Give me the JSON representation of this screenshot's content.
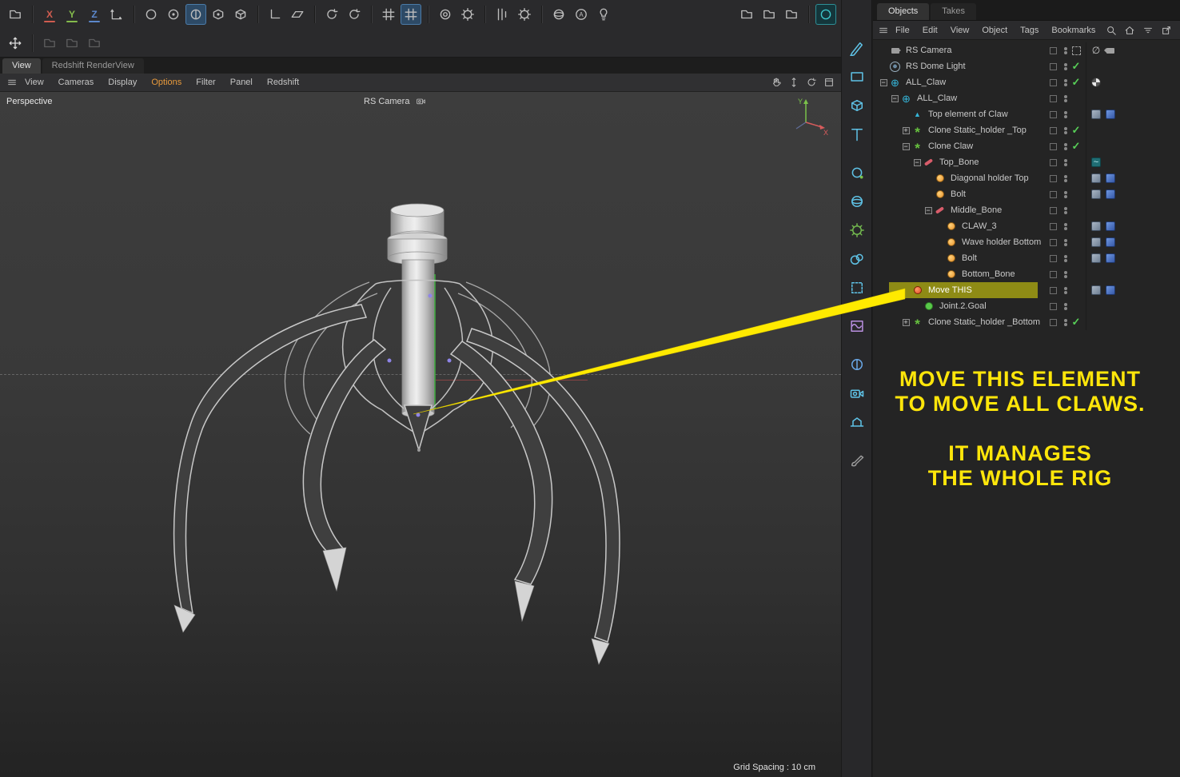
{
  "toolbar": {
    "row1": [
      {
        "items": [
          {
            "name": "content-browser-button",
            "icon": "foldbox"
          }
        ]
      },
      {
        "items": [
          {
            "name": "lock-x-axis-button",
            "letter": "X",
            "color": "#d05c50"
          },
          {
            "name": "lock-y-axis-button",
            "letter": "Y",
            "color": "#84bb4c"
          },
          {
            "name": "lock-z-axis-button",
            "letter": "Z",
            "color": "#5c88cc"
          },
          {
            "name": "coordinate-system-button",
            "icon": "axes"
          }
        ]
      },
      {
        "items": [
          {
            "name": "make-editable-button",
            "icon": "ring"
          },
          {
            "name": "model-mode-button",
            "icon": "ringdot"
          },
          {
            "name": "texture-mode-button",
            "icon": "halfring",
            "active": true
          },
          {
            "name": "point-mode-button",
            "icon": "cubedot"
          },
          {
            "name": "polygon-mode-button",
            "icon": "cube"
          }
        ]
      },
      {
        "items": [
          {
            "name": "enable-axis-button",
            "icon": "corner"
          },
          {
            "name": "workplane-button",
            "icon": "plane"
          }
        ]
      },
      {
        "items": [
          {
            "name": "reset-psr-button",
            "icon": "rotate"
          },
          {
            "name": "rotate-snap-button",
            "icon": "rotate"
          }
        ]
      },
      {
        "items": [
          {
            "name": "snap-toggle-button",
            "icon": "grid"
          },
          {
            "name": "quantize-button",
            "icon": "grid",
            "active": true
          }
        ]
      },
      {
        "items": [
          {
            "name": "target-mode-button",
            "icon": "target"
          },
          {
            "name": "snap-settings-button",
            "icon": "gearring"
          }
        ]
      },
      {
        "items": [
          {
            "name": "guide-lines-button",
            "icon": "lines"
          },
          {
            "name": "modeling-settings-button",
            "icon": "gearring"
          }
        ]
      },
      {
        "items": [
          {
            "name": "sphere-tool-button",
            "icon": "sphere"
          },
          {
            "name": "annotate-tool-button",
            "icon": "lettera"
          },
          {
            "name": "pick-tool-button",
            "icon": "lamp"
          }
        ]
      },
      {
        "push": true,
        "items": [
          {
            "name": "workplane-preset-1-button",
            "icon": "foldbox"
          },
          {
            "name": "workplane-preset-2-button",
            "icon": "foldbox"
          },
          {
            "name": "workplane-preset-3-button",
            "icon": "foldbox"
          }
        ]
      },
      {
        "items": [
          {
            "name": "modeling-circle-button",
            "icon": "ring",
            "accent": true,
            "color": "#3ec8cc"
          }
        ]
      }
    ],
    "row2": [
      {
        "items": [
          {
            "name": "move-tool-button",
            "icon": "movearrows",
            "color": "#d8d8d8"
          }
        ]
      },
      {
        "items": [
          {
            "name": "recent-tool-1-button",
            "icon": "foldbox",
            "disabled": true
          },
          {
            "name": "recent-tool-2-button",
            "icon": "foldbox",
            "disabled": true
          },
          {
            "name": "recent-tool-3-button",
            "icon": "foldbox",
            "disabled": true
          }
        ]
      }
    ]
  },
  "palette": [
    {
      "name": "spline-pen-tool",
      "icon": "pen",
      "color": "#5fc3e7"
    },
    {
      "name": "spline-primitive-tool",
      "icon": "rect",
      "color": "#5fc3e7"
    },
    {
      "name": "primitive-cube-tool",
      "icon": "cube",
      "color": "#5fc3e7"
    },
    {
      "name": "mograph-text-tool",
      "icon": "text",
      "color": "#5fc3e7"
    },
    {
      "name": "generator-tool",
      "icon": "gencircle",
      "color": "#5fc3e7",
      "gap": true
    },
    {
      "name": "subdivision-surface-tool",
      "icon": "sphere",
      "color": "#5fc3e7"
    },
    {
      "name": "simulation-tool",
      "icon": "gearring",
      "color": "#72b84e"
    },
    {
      "name": "volume-builder-tool",
      "icon": "blob",
      "color": "#5fc3e7"
    },
    {
      "name": "volume-mesher-tool",
      "icon": "dotcube",
      "color": "#5fc3e7"
    },
    {
      "name": "deformer-tool",
      "icon": "wavecube",
      "color": "#b98fe0",
      "gap": true
    },
    {
      "name": "field-tool",
      "icon": "fieldsphere",
      "color": "#6aa8e8",
      "gap": true
    },
    {
      "name": "camera-tool",
      "icon": "camera",
      "color": "#5fc3e7"
    },
    {
      "name": "stage-tool",
      "icon": "stage",
      "color": "#5fc3e7"
    },
    {
      "name": "material-paint-tool",
      "icon": "brush",
      "color": "#9a9a9a",
      "gap": true
    }
  ],
  "viewport": {
    "tabs": [
      {
        "label": "View",
        "active": true
      },
      {
        "label": "Redshift RenderView",
        "active": false
      }
    ],
    "menu": [
      {
        "label": "View"
      },
      {
        "label": "Cameras"
      },
      {
        "label": "Display"
      },
      {
        "label": "Options",
        "accent": true
      },
      {
        "label": "Filter"
      },
      {
        "label": "Panel"
      },
      {
        "label": "Redshift"
      }
    ],
    "menu_icons": [
      {
        "name": "pan-view-icon",
        "icon": "hand"
      },
      {
        "name": "dolly-view-icon",
        "icon": "updown"
      },
      {
        "name": "rotate-view-icon",
        "icon": "rotate"
      },
      {
        "name": "toggle-panel-icon",
        "icon": "frame"
      }
    ],
    "view_label": "Perspective",
    "camera_label": "RS Camera",
    "grid_spacing_label": "Grid Spacing : 10 cm",
    "axis_labels": {
      "x": "X",
      "y": "Y"
    }
  },
  "object_manager": {
    "tabs": [
      {
        "label": "Objects",
        "active": true
      },
      {
        "label": "Takes",
        "active": false
      }
    ],
    "menu": [
      "File",
      "Edit",
      "View",
      "Object",
      "Tags",
      "Bookmarks"
    ],
    "menu_icons": [
      {
        "name": "search-icon",
        "icon": "magnifier"
      },
      {
        "name": "home-icon",
        "icon": "home"
      },
      {
        "name": "filter-icon",
        "icon": "filter"
      },
      {
        "name": "new-window-icon",
        "icon": "export"
      }
    ],
    "rows": [
      {
        "label": "RS Camera",
        "indent": 0,
        "icon": "camera",
        "pre": "marquee",
        "tags": [
          "nodraw",
          "camtag"
        ]
      },
      {
        "label": "RS Dome Light",
        "indent": 0,
        "icon": "domelight",
        "pre": "check",
        "tags": []
      },
      {
        "label": "ALL_Claw",
        "indent": 0,
        "icon": "null",
        "expand": "minus",
        "pre": "check",
        "tags": [
          "spheretex"
        ]
      },
      {
        "label": "ALL_Claw",
        "indent": 1,
        "icon": "null",
        "expand": "minus",
        "pre": "",
        "tags": []
      },
      {
        "label": "Top element of Claw",
        "indent": 2,
        "icon": "spline",
        "pre": "",
        "tags": [
          "weight",
          "flag"
        ]
      },
      {
        "label": "Clone Static_holder _Top",
        "indent": 2,
        "icon": "cloner",
        "expand": "plus",
        "pre": "check",
        "tags": []
      },
      {
        "label": "Clone Claw",
        "indent": 2,
        "icon": "cloner",
        "expand": "minus",
        "pre": "check",
        "tags": []
      },
      {
        "label": "Top_Bone",
        "indent": 3,
        "icon": "bone",
        "expand": "minus",
        "pre": "",
        "tags": [
          "jiggle"
        ]
      },
      {
        "label": "Diagonal  holder Top",
        "indent": 4,
        "icon": "joint",
        "pre": "",
        "tags": [
          "weight",
          "flag"
        ]
      },
      {
        "label": "Bolt",
        "indent": 4,
        "icon": "joint",
        "pre": "",
        "tags": [
          "weight",
          "flag"
        ]
      },
      {
        "label": "Middle_Bone",
        "indent": 4,
        "icon": "bone",
        "expand": "minus",
        "pre": "",
        "tags": []
      },
      {
        "label": "CLAW_3",
        "indent": 5,
        "icon": "joint",
        "pre": "",
        "tags": [
          "weight",
          "flag"
        ]
      },
      {
        "label": "Wave holder Bottom",
        "indent": 5,
        "icon": "joint",
        "pre": "",
        "tags": [
          "weight",
          "flag"
        ]
      },
      {
        "label": "Bolt",
        "indent": 5,
        "icon": "joint",
        "pre": "",
        "tags": [
          "weight",
          "flag"
        ]
      },
      {
        "label": "Bottom_Bone",
        "indent": 5,
        "icon": "joint",
        "pre": "",
        "tags": []
      },
      {
        "label": "Move THIS",
        "indent": 2,
        "icon": "movethis",
        "hl": true,
        "pre": "",
        "tags": [
          "weight",
          "flag"
        ]
      },
      {
        "label": "Joint.2.Goal",
        "indent": 3,
        "icon": "goal",
        "pre": "",
        "tags": []
      },
      {
        "label": "Clone Static_holder _Bottom",
        "indent": 2,
        "icon": "cloner",
        "expand": "plus",
        "pre": "check",
        "tags": []
      }
    ]
  },
  "annotation": {
    "line1": "MOVE THIS ELEMENT",
    "line2": "TO MOVE ALL CLAWS.",
    "line3": "IT MANAGES",
    "line4": "THE WHOLE RIG",
    "color": "#ffe60a",
    "arrow_color": "#ffea00"
  }
}
